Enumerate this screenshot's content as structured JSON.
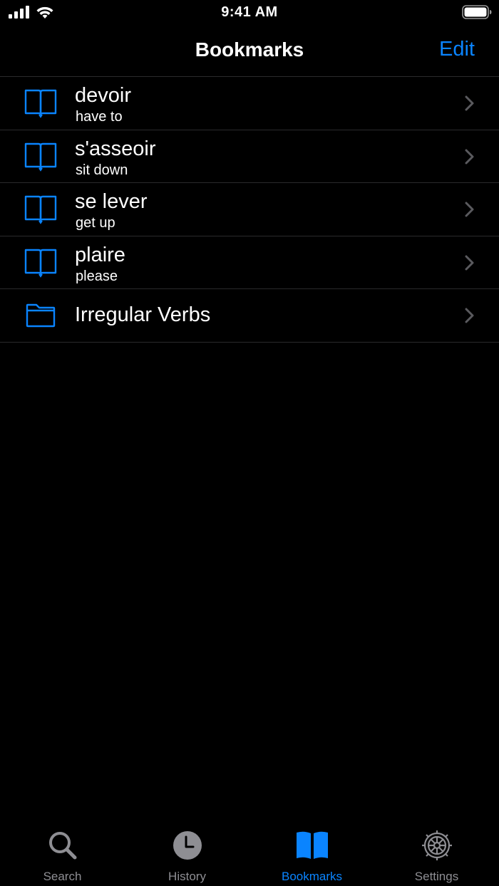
{
  "status_bar": {
    "time": "9:41 AM"
  },
  "nav": {
    "title": "Bookmarks",
    "edit_label": "Edit"
  },
  "bookmarks": [
    {
      "title": "devoir",
      "subtitle": "have to",
      "icon": "book-icon"
    },
    {
      "title": "s'asseoir",
      "subtitle": "sit down",
      "icon": "book-icon"
    },
    {
      "title": "se lever",
      "subtitle": "get up",
      "icon": "book-icon"
    },
    {
      "title": "plaire",
      "subtitle": "please",
      "icon": "book-icon"
    }
  ],
  "folders": [
    {
      "title": "Irregular Verbs",
      "icon": "folder-icon"
    }
  ],
  "tabs": [
    {
      "label": "Search",
      "icon": "magnifying-glass-icon",
      "active": false
    },
    {
      "label": "History",
      "icon": "clock-icon",
      "active": false
    },
    {
      "label": "Bookmarks",
      "icon": "open-book-icon",
      "active": true
    },
    {
      "label": "Settings",
      "icon": "gear-icon",
      "active": false
    }
  ],
  "colors": {
    "accent": "#0a84ff",
    "background": "#000000",
    "separator": "#2a2a2c",
    "inactive": "#8e8e93",
    "chevron": "#5a5a5e"
  }
}
